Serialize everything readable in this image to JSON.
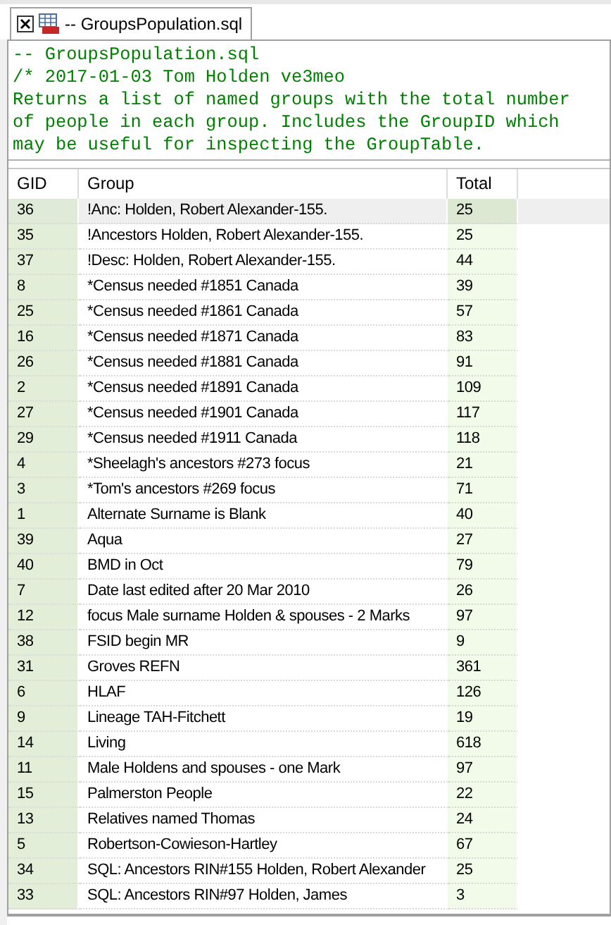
{
  "tab": {
    "title": "-- GroupsPopulation.sql",
    "selected": true
  },
  "editor": {
    "lines": [
      "-- GroupsPopulation.sql",
      "/* 2017-01-03 Tom Holden ve3meo",
      "Returns a list of named groups with the total number",
      "of people in each group. Includes the GroupID which",
      "may be useful for inspecting the GroupTable."
    ]
  },
  "table": {
    "columns": [
      "GID",
      "Group",
      "Total"
    ],
    "rows": [
      {
        "gid": "36",
        "group": "!Anc: Holden, Robert Alexander-155.",
        "total": "25",
        "selected": true
      },
      {
        "gid": "35",
        "group": "!Ancestors Holden, Robert Alexander-155.",
        "total": "25",
        "selected": false
      },
      {
        "gid": "37",
        "group": "!Desc: Holden, Robert Alexander-155.",
        "total": "44",
        "selected": false
      },
      {
        "gid": "8",
        "group": "*Census needed #1851 Canada",
        "total": "39",
        "selected": false
      },
      {
        "gid": "25",
        "group": "*Census needed #1861 Canada",
        "total": "57",
        "selected": false
      },
      {
        "gid": "16",
        "group": "*Census needed #1871 Canada",
        "total": "83",
        "selected": false
      },
      {
        "gid": "26",
        "group": "*Census needed #1881 Canada",
        "total": "91",
        "selected": false
      },
      {
        "gid": "2",
        "group": "*Census needed #1891 Canada",
        "total": "109",
        "selected": false
      },
      {
        "gid": "27",
        "group": "*Census needed #1901 Canada",
        "total": "117",
        "selected": false
      },
      {
        "gid": "29",
        "group": "*Census needed #1911 Canada",
        "total": "118",
        "selected": false
      },
      {
        "gid": "4",
        "group": "*Sheelagh's ancestors #273 focus",
        "total": "21",
        "selected": false
      },
      {
        "gid": "3",
        "group": "*Tom's ancestors #269 focus",
        "total": "71",
        "selected": false
      },
      {
        "gid": "1",
        "group": "Alternate Surname is Blank",
        "total": "40",
        "selected": false
      },
      {
        "gid": "39",
        "group": "Aqua",
        "total": "27",
        "selected": false
      },
      {
        "gid": "40",
        "group": "BMD in Oct",
        "total": "79",
        "selected": false
      },
      {
        "gid": "7",
        "group": "Date last edited after 20 Mar 2010",
        "total": "26",
        "selected": false
      },
      {
        "gid": "12",
        "group": "focus Male surname Holden & spouses - 2 Marks",
        "total": "97",
        "selected": false
      },
      {
        "gid": "38",
        "group": "FSID begin MR",
        "total": "9",
        "selected": false
      },
      {
        "gid": "31",
        "group": "Groves REFN",
        "total": "361",
        "selected": false
      },
      {
        "gid": "6",
        "group": "HLAF",
        "total": "126",
        "selected": false
      },
      {
        "gid": "9",
        "group": "Lineage TAH-Fitchett",
        "total": "19",
        "selected": false
      },
      {
        "gid": "14",
        "group": "Living",
        "total": "618",
        "selected": false
      },
      {
        "gid": "11",
        "group": "Male Holdens and spouses - one Mark",
        "total": "97",
        "selected": false
      },
      {
        "gid": "15",
        "group": "Palmerston People",
        "total": "22",
        "selected": false
      },
      {
        "gid": "13",
        "group": "Relatives named Thomas",
        "total": "24",
        "selected": false
      },
      {
        "gid": "5",
        "group": "Robertson-Cowieson-Hartley",
        "total": "67",
        "selected": false
      },
      {
        "gid": "34",
        "group": "SQL: Ancestors RIN#155 Holden, Robert Alexander",
        "total": "25",
        "selected": false
      },
      {
        "gid": "33",
        "group": "SQL: Ancestors RIN#97 Holden, James",
        "total": "3",
        "selected": false
      }
    ]
  }
}
